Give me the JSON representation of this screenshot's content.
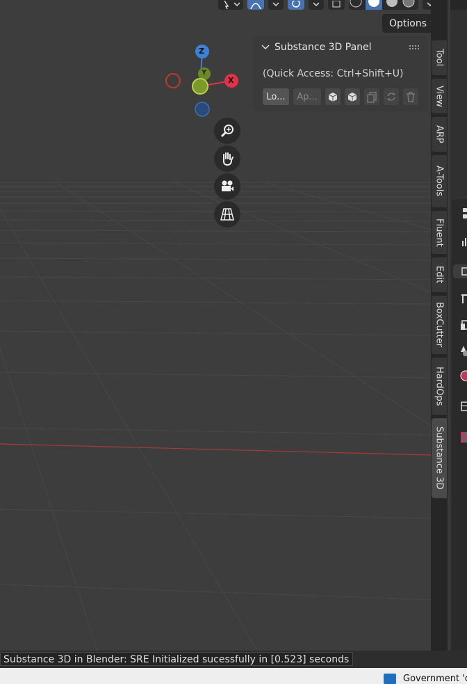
{
  "viewport": {
    "options_label": "Options",
    "gizmo": {
      "z_label": "Z",
      "y_label": "Y",
      "x_label": "X"
    },
    "nav_tools": [
      {
        "name": "zoom",
        "icon": "zoom-icon"
      },
      {
        "name": "pan",
        "icon": "hand-icon"
      },
      {
        "name": "camera",
        "icon": "camera-icon"
      },
      {
        "name": "ortho",
        "icon": "grid-perspective-icon"
      }
    ],
    "colors": {
      "background": "#3d3d3d",
      "grid": "#4a4a4a",
      "x_axis": "#b03a3a",
      "gizmo_x": "#e0334a",
      "gizmo_y": "#86a82e",
      "gizmo_z": "#3b82d6"
    }
  },
  "panel": {
    "title": "Substance 3D Panel",
    "quick_access": "(Quick Access: Ctrl+Shift+U)",
    "load_button": "Lo...",
    "apply_button": "Ap..."
  },
  "sidebar_tabs": [
    {
      "label": "Tool"
    },
    {
      "label": "View"
    },
    {
      "label": "ARP"
    },
    {
      "label": "A-Tools"
    },
    {
      "label": "Fluent"
    },
    {
      "label": "Edit"
    },
    {
      "label": "BoxCutter"
    },
    {
      "label": "HardOps"
    },
    {
      "label": "Substance 3D",
      "active": true
    }
  ],
  "status": {
    "message": "Substance 3D in Blender: SRE Initialized sucessfully in [0.523] seconds"
  },
  "taskbar": {
    "item_label": "Government 'c"
  }
}
